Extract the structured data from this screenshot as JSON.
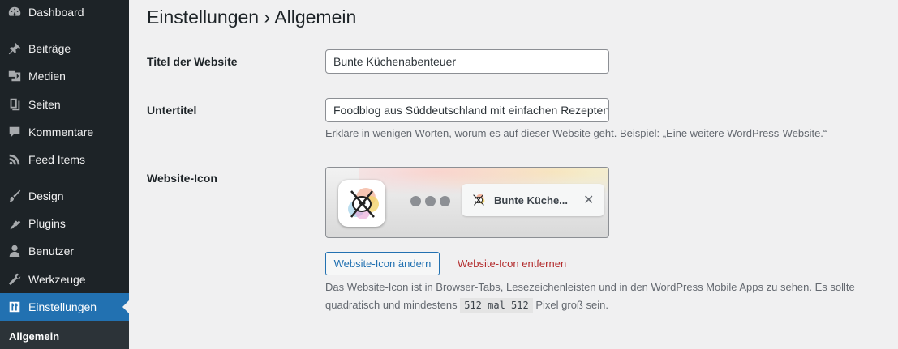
{
  "sidebar": {
    "items": [
      {
        "label": "Dashboard",
        "icon": "dashboard-icon"
      },
      {
        "label": "Beiträge",
        "icon": "pin-icon"
      },
      {
        "label": "Medien",
        "icon": "media-icon"
      },
      {
        "label": "Seiten",
        "icon": "pages-icon"
      },
      {
        "label": "Kommentare",
        "icon": "comment-icon"
      },
      {
        "label": "Feed Items",
        "icon": "rss-icon"
      },
      {
        "label": "Design",
        "icon": "brush-icon"
      },
      {
        "label": "Plugins",
        "icon": "plugin-icon"
      },
      {
        "label": "Benutzer",
        "icon": "user-icon"
      },
      {
        "label": "Werkzeuge",
        "icon": "wrench-icon"
      },
      {
        "label": "Einstellungen",
        "icon": "settings-icon",
        "current": true
      }
    ],
    "submenu": {
      "label": "Allgemein"
    }
  },
  "page": {
    "title": "Einstellungen › Allgemein"
  },
  "form": {
    "site_title": {
      "label": "Titel der Website",
      "value": "Bunte Küchenabenteuer"
    },
    "tagline": {
      "label": "Untertitel",
      "value": "Foodblog aus Süddeutschland mit einfachen Rezepten",
      "description": "Erkläre in wenigen Worten, worum es auf dieser Website geht. Beispiel: „Eine weitere WordPress-Website.“"
    },
    "site_icon": {
      "label": "Website-Icon",
      "preview_tab_title": "Bunte Küche...",
      "preview_close": "✕",
      "change_button": "Website-Icon ändern",
      "remove_button": "Website-Icon entfernen",
      "description_part1": "Das Website-Icon ist in Browser-Tabs, Lesezeichenleisten und in den WordPress Mobile Apps zu sehen. Es sollte quadratisch und mindestens",
      "description_code": "512 mal 512",
      "description_part2": "Pixel groß sein."
    }
  },
  "colors": {
    "sidebar_bg": "#1d2327",
    "accent": "#2271b1",
    "danger": "#b32d2e"
  }
}
